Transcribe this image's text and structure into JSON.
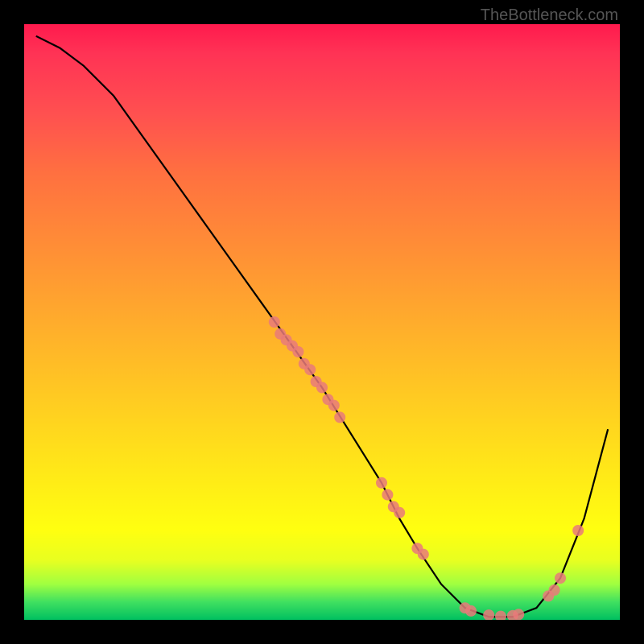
{
  "watermark": "TheBottleneck.com",
  "chart_data": {
    "type": "line",
    "title": "",
    "xlabel": "",
    "ylabel": "",
    "xlim": [
      0,
      100
    ],
    "ylim": [
      0,
      100
    ],
    "series": [
      {
        "name": "curve",
        "x": [
          2,
          6,
          10,
          15,
          20,
          25,
          30,
          35,
          40,
          45,
          50,
          55,
          60,
          63,
          66,
          70,
          74,
          78,
          82,
          86,
          90,
          94,
          98
        ],
        "y": [
          98,
          96,
          93,
          88,
          81,
          74,
          67,
          60,
          53,
          46,
          39,
          31,
          23,
          17,
          12,
          6,
          2,
          0.5,
          0.5,
          2,
          7,
          17,
          32
        ]
      }
    ],
    "scatter_points": {
      "name": "markers",
      "color": "#e97a7a",
      "points": [
        {
          "x": 42,
          "y": 50
        },
        {
          "x": 43,
          "y": 48
        },
        {
          "x": 44,
          "y": 47
        },
        {
          "x": 45,
          "y": 46
        },
        {
          "x": 46,
          "y": 45
        },
        {
          "x": 47,
          "y": 43
        },
        {
          "x": 48,
          "y": 42
        },
        {
          "x": 49,
          "y": 40
        },
        {
          "x": 50,
          "y": 39
        },
        {
          "x": 51,
          "y": 37
        },
        {
          "x": 52,
          "y": 36
        },
        {
          "x": 53,
          "y": 34
        },
        {
          "x": 60,
          "y": 23
        },
        {
          "x": 61,
          "y": 21
        },
        {
          "x": 62,
          "y": 19
        },
        {
          "x": 63,
          "y": 18
        },
        {
          "x": 66,
          "y": 12
        },
        {
          "x": 67,
          "y": 11
        },
        {
          "x": 74,
          "y": 2
        },
        {
          "x": 75,
          "y": 1.5
        },
        {
          "x": 78,
          "y": 0.8
        },
        {
          "x": 80,
          "y": 0.6
        },
        {
          "x": 82,
          "y": 0.7
        },
        {
          "x": 83,
          "y": 0.9
        },
        {
          "x": 88,
          "y": 4
        },
        {
          "x": 89,
          "y": 5
        },
        {
          "x": 90,
          "y": 7
        },
        {
          "x": 93,
          "y": 15
        }
      ]
    }
  }
}
